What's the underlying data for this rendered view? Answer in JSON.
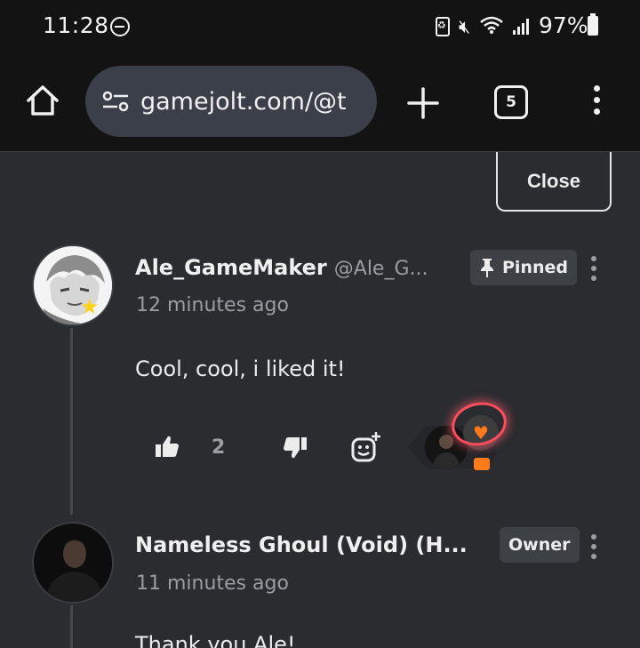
{
  "status_bar": {
    "time": "11:28",
    "battery": "97%"
  },
  "browser": {
    "url": "gamejolt.com/@t",
    "tab_count": "5"
  },
  "page": {
    "close_label": "Close",
    "comments": [
      {
        "username": "Ale_GameMaker",
        "handle": "@Ale_G...",
        "badge": "Pinned",
        "timestamp": "12 minutes ago",
        "text": "Cool, cool, i liked it!",
        "like_count": "2"
      },
      {
        "username": "Nameless Ghoul (Void) (H...",
        "badge": "Owner",
        "timestamp": "11 minutes ago",
        "text": "Thank you Ale!"
      }
    ]
  },
  "colors": {
    "background": "#2a2c2f",
    "topbar": "#131313",
    "url_bar": "#3b3f4a",
    "heart": "#ff7a1a",
    "highlight": "#ff4d5e"
  },
  "icons": [
    "home-icon",
    "site-settings-icon",
    "new-tab-icon",
    "tabs-icon",
    "menu-icon",
    "pin-icon",
    "thumbs-up-icon",
    "thumbs-down-icon",
    "add-reaction-icon",
    "heart-icon"
  ]
}
